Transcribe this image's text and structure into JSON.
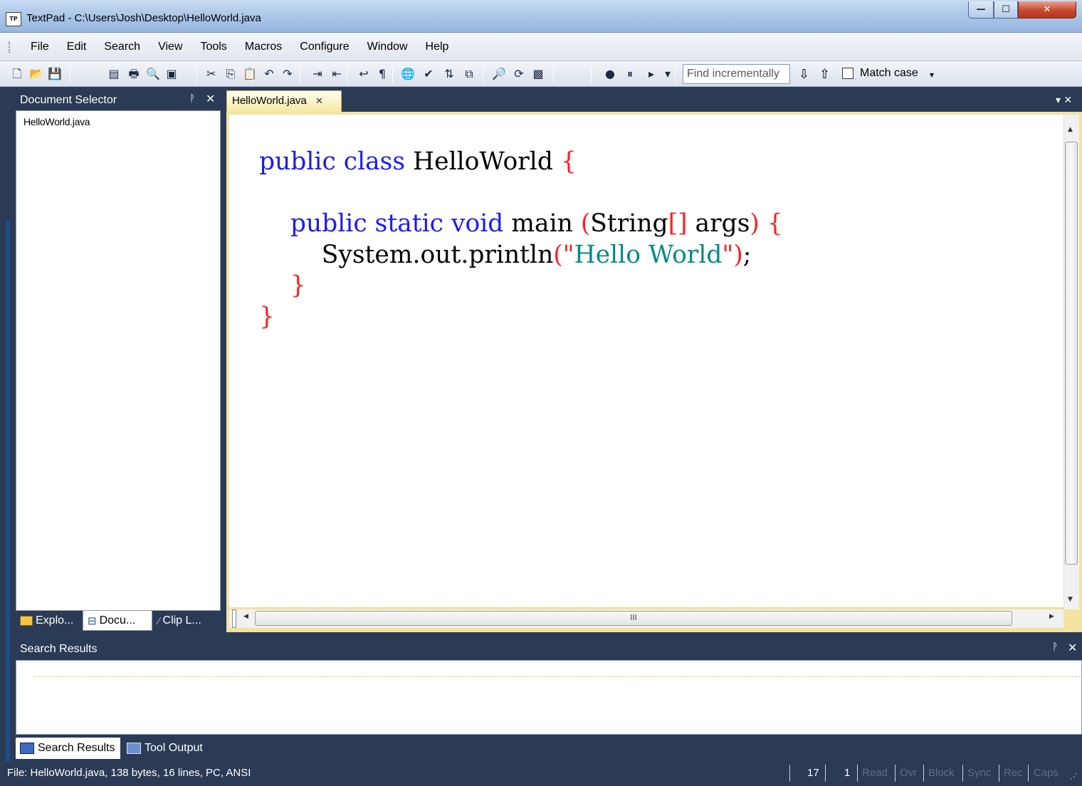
{
  "window": {
    "title": "TextPad - C:\\Users\\Josh\\Desktop\\HelloWorld.java",
    "app_icon_text": "TP",
    "controls": {
      "minimize": "—",
      "maximize": "☐",
      "close": "✕"
    }
  },
  "menu": [
    "File",
    "Edit",
    "Search",
    "View",
    "Tools",
    "Macros",
    "Configure",
    "Window",
    "Help"
  ],
  "toolbar": {
    "icons": [
      {
        "name": "new-file-icon",
        "glyph": "🗋"
      },
      {
        "name": "open-file-icon",
        "glyph": "📂"
      },
      {
        "name": "save-icon",
        "glyph": "💾"
      },
      {
        "name": "save-all-icon",
        "glyph": "▤"
      },
      {
        "name": "print-icon",
        "glyph": "🖶"
      },
      {
        "name": "print-preview-icon",
        "glyph": "🔍"
      },
      {
        "name": "page-view-icon",
        "glyph": "▣"
      },
      {
        "name": "cut-icon",
        "glyph": "✂"
      },
      {
        "name": "copy-icon",
        "glyph": "⎘"
      },
      {
        "name": "paste-icon",
        "glyph": "📋"
      },
      {
        "name": "undo-icon",
        "glyph": "↶"
      },
      {
        "name": "redo-icon",
        "glyph": "↷"
      },
      {
        "name": "indent-icon",
        "glyph": "⇥"
      },
      {
        "name": "outdent-icon",
        "glyph": "⇤"
      },
      {
        "name": "word-wrap-icon",
        "glyph": "↩"
      },
      {
        "name": "visible-spaces-icon",
        "glyph": "¶"
      },
      {
        "name": "web-browser-icon",
        "glyph": "🌐"
      },
      {
        "name": "spell-check-icon",
        "glyph": "✔"
      },
      {
        "name": "sort-icon",
        "glyph": "⇅"
      },
      {
        "name": "compare-icon",
        "glyph": "⧉"
      },
      {
        "name": "find-icon",
        "glyph": "🔎"
      },
      {
        "name": "replace-icon",
        "glyph": "⟳"
      },
      {
        "name": "find-in-files-icon",
        "glyph": "▩"
      },
      {
        "name": "record-macro-icon",
        "glyph": "●"
      },
      {
        "name": "pause-macro-icon",
        "glyph": "⏸"
      },
      {
        "name": "play-macro-icon",
        "glyph": "▸"
      },
      {
        "name": "toolbar-options-icon",
        "glyph": "▾"
      }
    ],
    "find_placeholder": "Find incrementally",
    "find_next_icon": "⇩",
    "find_prev_icon": "⇧",
    "match_case_label": "Match case",
    "match_case_checked": false
  },
  "document_selector": {
    "title": "Document Selector",
    "pin": "ᚹ",
    "close": "✕",
    "items": [
      "HelloWorld.java"
    ],
    "tabs": [
      {
        "label": "Explo...",
        "icon": "explorer-icon",
        "active": false
      },
      {
        "label": "Docu...",
        "icon": "document-selector-icon",
        "active": true
      },
      {
        "label": "Clip L...",
        "icon": "clip-library-icon",
        "active": false
      }
    ]
  },
  "editor": {
    "tab_label": "HelloWorld.java",
    "tab_close": "✕",
    "tab_strip_ctrl": "▾ ✕",
    "code_lines": [
      "public class HelloWorld {",
      "",
      "    public static void main (String[] args) {",
      "        System.out.println(\"Hello World\");",
      "    }",
      "}"
    ],
    "hscroll_grip": "III"
  },
  "search_results": {
    "title": "Search Results",
    "pin": "ᚹ",
    "close": "✕",
    "tabs": [
      {
        "label": "Search Results",
        "active": true
      },
      {
        "label": "Tool Output",
        "active": false
      }
    ]
  },
  "status": {
    "text": "File: HelloWorld.java, 138 bytes, 16 lines, PC, ANSI",
    "line": "17",
    "col": "1",
    "indicators": [
      "Read",
      "Ovr",
      "Block",
      "Sync",
      "Rec",
      "Caps"
    ]
  },
  "colors": {
    "keyword": "#1a1aff",
    "bracket": "#ff2020",
    "string": "#008a8a",
    "panel_dark": "#2b3a55"
  }
}
